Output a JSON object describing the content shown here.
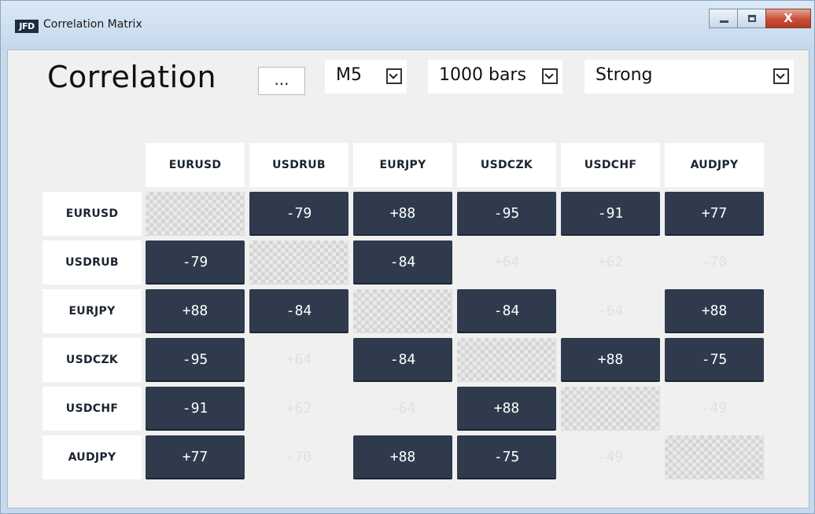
{
  "window": {
    "icon_text": "JFD",
    "title": "Correlation Matrix",
    "close_glyph": "X"
  },
  "toolbar": {
    "heading": "Correlation",
    "ellipsis_label": "...",
    "timeframe": "M5",
    "bars": "1000 bars",
    "filter": "Strong"
  },
  "matrix": {
    "symbols": [
      "EURUSD",
      "USDRUB",
      "EURJPY",
      "USDCZK",
      "USDCHF",
      "AUDJPY"
    ],
    "rows": [
      [
        null,
        "-79",
        "+88",
        "-95",
        "-91",
        "+77"
      ],
      [
        "-79",
        null,
        "-84",
        "+64",
        "+62",
        "-70"
      ],
      [
        "+88",
        "-84",
        null,
        "-84",
        "-64",
        "+88"
      ],
      [
        "-95",
        "+64",
        "-84",
        null,
        "+88",
        "-75"
      ],
      [
        "-91",
        "+62",
        "-64",
        "+88",
        null,
        "-49"
      ],
      [
        "+77",
        "-70",
        "+88",
        "-75",
        "-49",
        null
      ]
    ],
    "strong_mask": [
      [
        false,
        true,
        true,
        true,
        true,
        true
      ],
      [
        true,
        false,
        true,
        false,
        false,
        false
      ],
      [
        true,
        true,
        false,
        true,
        false,
        true
      ],
      [
        true,
        false,
        true,
        false,
        true,
        true
      ],
      [
        true,
        false,
        false,
        true,
        false,
        false
      ],
      [
        true,
        false,
        true,
        true,
        false,
        false
      ]
    ],
    "colors": {
      "strong_cell": "#2f3b4d",
      "weak_text": "#dde2e7"
    }
  }
}
